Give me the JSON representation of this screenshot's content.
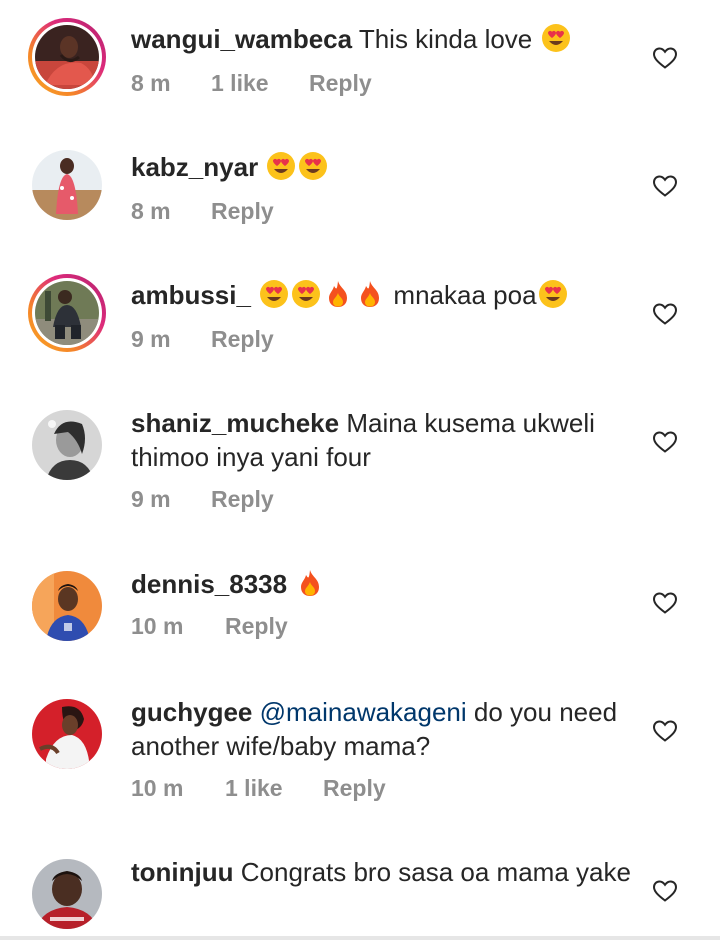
{
  "comments": [
    {
      "username": "wangui_wambeca",
      "text": "This kinda love",
      "emojis_after": [
        "heart-eyes"
      ],
      "time": "8 m",
      "likes": "1 like",
      "reply": "Reply",
      "has_story_ring": true
    },
    {
      "username": "kabz_nyar",
      "text": "",
      "emojis_after": [
        "heart-eyes",
        "heart-eyes"
      ],
      "time": "8 m",
      "likes": "",
      "reply": "Reply",
      "has_story_ring": false
    },
    {
      "username": "ambussi_",
      "text_after": "mnakaa poa",
      "emojis_before": [
        "heart-eyes",
        "heart-eyes",
        "fire",
        "fire"
      ],
      "emojis_after": [
        "heart-eyes"
      ],
      "time": "9 m",
      "likes": "",
      "reply": "Reply",
      "has_story_ring": true
    },
    {
      "username": "shaniz_mucheke",
      "text": "Maina kusema ukweli thimoo inya yani four",
      "time": "9 m",
      "likes": "",
      "reply": "Reply",
      "has_story_ring": false
    },
    {
      "username": "dennis_8338",
      "text": "",
      "emojis_after": [
        "fire"
      ],
      "time": "10 m",
      "likes": "",
      "reply": "Reply",
      "has_story_ring": false
    },
    {
      "username": "guchygee",
      "mention": "@mainawakageni",
      "text": "do you need another  wife/baby mama?",
      "time": "10 m",
      "likes": "1 like",
      "reply": "Reply",
      "has_story_ring": false
    },
    {
      "username": "toninjuu",
      "text": "Congrats bro sasa oa mama yake",
      "time": "",
      "likes": "",
      "reply": "",
      "has_story_ring": false
    }
  ],
  "colors": {
    "text": "#262626",
    "meta": "#8e8e8e",
    "mention": "#00376b",
    "ring_start": "#f9a825",
    "ring_end": "#b1236f"
  },
  "icons": {
    "like": "heart-outline-icon",
    "heart_eyes": "heart-eyes-emoji-icon",
    "fire": "fire-emoji-icon"
  }
}
